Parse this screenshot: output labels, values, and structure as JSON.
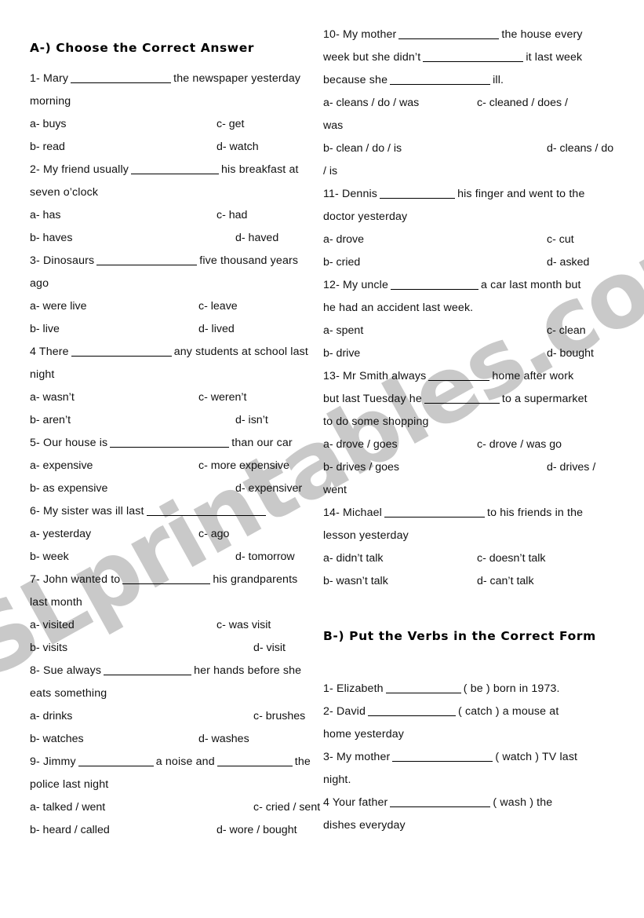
{
  "watermark": {
    "text": "ESLprintables.com",
    "color": "#c9c9c9"
  },
  "sections": {
    "a": {
      "heading": "A-) Choose the Correct Answer"
    },
    "b": {
      "heading": "B-) Put the Verbs in the Correct Form"
    }
  },
  "left_column": {
    "q1": {
      "line1_pre": "1- Mary",
      "line1_post": "the newspaper yesterday",
      "line2": "morning",
      "a": "a- buys",
      "b": "b- read",
      "c": "c- get",
      "d": "d- watch"
    },
    "q2": {
      "line1_pre": "2- My friend usually",
      "line1_post": "his breakfast at",
      "line2": "seven o’clock",
      "a": "a- has",
      "b": "b- haves",
      "c": "c- had",
      "d": "d- haved"
    },
    "q3": {
      "line1_pre": "3- Dinosaurs",
      "line1_post": "five thousand years",
      "line2": "ago",
      "a": "a- were live",
      "b": "b- live",
      "c": "c- leave",
      "d": "d- lived"
    },
    "q4": {
      "line1_pre": "4 There",
      "line1_post": "any students at school last",
      "line2": "night",
      "a": "a- wasn’t",
      "b": "b- aren’t",
      "c": "c- weren’t",
      "d": "d- isn’t"
    },
    "q5": {
      "line1_pre": "5- Our house is",
      "line1_post": "than our car",
      "a": "a- expensive",
      "b": "b- as expensive",
      "c": "c- more expensive",
      "d": "d- expensiver"
    },
    "q6": {
      "line1_pre": "6- My sister was ill last",
      "line1_post": "",
      "a": "a- yesterday",
      "b": "b- week",
      "c": "c- ago",
      "d": "d- tomorrow"
    },
    "q7": {
      "line1_pre": "7- John wanted to",
      "line1_post": "his grandparents",
      "line2": "last month",
      "a": "a- visited",
      "b": "b- visits",
      "c": "c- was visit",
      "d": "d- visit"
    },
    "q8": {
      "line1_pre": "8- Sue always",
      "line1_post": "her hands before she",
      "line2": "eats something",
      "a": "a- drinks",
      "b": "b- watches",
      "c": "c- brushes",
      "d": "d- washes"
    },
    "q9": {
      "line1_pre": "9- Jimmy",
      "line1_mid": "a noise and",
      "line1_post": "the",
      "line2": "police last night",
      "a": "a- talked / went",
      "b": "b- heard / called",
      "c": "c- cried / sent",
      "d": "d- wore / bought"
    }
  },
  "right_column": {
    "q10": {
      "line1_pre": "10- My mother",
      "line1_post": "the house every",
      "line2_pre": "week but she didn’t",
      "line2_post": "it last week",
      "line3_pre": "because she",
      "line3_post": "ill.",
      "a": "a- cleans / do / was",
      "c": "c- cleaned / does /",
      "c_cont": "was",
      "b": "b- clean / do / is",
      "d": "d- cleans / do",
      "d_cont": "/ is"
    },
    "q11": {
      "line1_pre": "11- Dennis",
      "line1_post": "his finger and went to the",
      "line2": "doctor yesterday",
      "a": "a- drove",
      "b": "b- cried",
      "c": "c- cut",
      "d": "d- asked"
    },
    "q12": {
      "line1_pre": "12- My uncle",
      "line1_post": "a car last month but",
      "line2": "he had an accident last week.",
      "a": "a- spent",
      "b": "b- drive",
      "c": "c- clean",
      "d": "d- bought"
    },
    "q13": {
      "line1_pre": "13- Mr Smith always",
      "line1_post": "home after work",
      "line2_pre": "but last Tuesday he",
      "line2_post": "to a supermarket",
      "line3": "to do some shopping",
      "a": "a- drove / goes",
      "b": "b- drives / goes",
      "c": "c- drove / was go",
      "d": "d- drives /",
      "d_cont": "went"
    },
    "q14": {
      "line1_pre": "14- Michael",
      "line1_post": "to his friends in the",
      "line2": "lesson yesterday",
      "a": "a- didn’t talk",
      "b": "b- wasn’t talk",
      "c": "c- doesn’t talk",
      "d": "d- can’t talk"
    },
    "b1": {
      "line1_pre": "1- Elizabeth",
      "line1_post": "( be ) born in 1973."
    },
    "b2": {
      "line1_pre": "2- David",
      "line1_post": "( catch ) a mouse at",
      "line2": "home yesterday"
    },
    "b3": {
      "line1_pre": "3- My mother",
      "line1_post": "( watch ) TV last",
      "line2": "night."
    },
    "b4": {
      "line1_pre": "4 Your father",
      "line1_post": "( wash ) the",
      "line2": "dishes everyday"
    }
  }
}
